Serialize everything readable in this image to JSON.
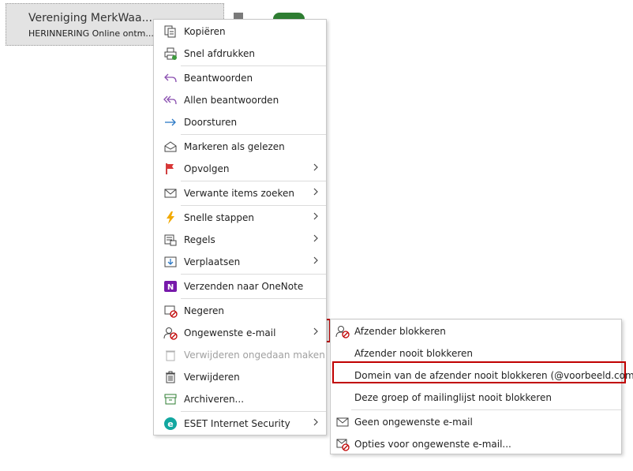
{
  "email": {
    "sender": "Vereniging MerkWaa...",
    "subject": "HERINNERING Online ontm..."
  },
  "menu": {
    "items": [
      {
        "label": "Kopiëren",
        "icon": "copy-icon"
      },
      {
        "label": "Snel afdrukken",
        "icon": "print-icon"
      },
      {
        "label": "Beantwoorden",
        "icon": "reply-icon"
      },
      {
        "label": "Allen beantwoorden",
        "icon": "reply-all-icon"
      },
      {
        "label": "Doorsturen",
        "icon": "forward-icon"
      },
      {
        "label": "Markeren als gelezen",
        "icon": "envelope-open-icon"
      },
      {
        "label": "Opvolgen",
        "icon": "flag-icon"
      },
      {
        "label": "Verwante items zoeken",
        "icon": "envelope-search-icon"
      },
      {
        "label": "Snelle stappen",
        "icon": "lightning-icon"
      },
      {
        "label": "Regels",
        "icon": "rules-icon"
      },
      {
        "label": "Verplaatsen",
        "icon": "move-icon"
      },
      {
        "label": "Verzenden naar OneNote",
        "icon": "onenote-icon"
      },
      {
        "label": "Negeren",
        "icon": "ignore-icon"
      },
      {
        "label": "Ongewenste e-mail",
        "icon": "junk-icon"
      },
      {
        "label": "Verwijderen ongedaan maken",
        "icon": "undelete-icon"
      },
      {
        "label": "Verwijderen",
        "icon": "trash-icon"
      },
      {
        "label": "Archiveren...",
        "icon": "archive-icon"
      },
      {
        "label": "ESET Internet Security",
        "icon": "eset-icon"
      }
    ]
  },
  "submenu": {
    "items": [
      {
        "label": "Afzender blokkeren",
        "icon": "block-sender-icon"
      },
      {
        "label": "Afzender nooit blokkeren"
      },
      {
        "label": "Domein van de afzender nooit blokkeren (@voorbeeld.com)"
      },
      {
        "label": "Deze groep of mailinglijst nooit blokkeren"
      },
      {
        "label": "Geen ongewenste e-mail",
        "icon": "not-junk-icon"
      },
      {
        "label": "Opties voor ongewenste e-mail...",
        "icon": "junk-options-icon"
      }
    ]
  },
  "colors": {
    "highlight_border": "#c00000",
    "selected_bg": "#e5e5e5"
  }
}
